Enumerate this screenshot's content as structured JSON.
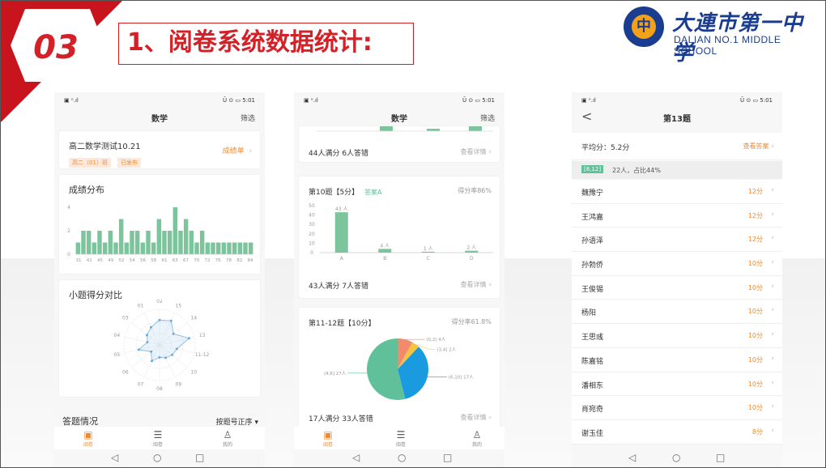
{
  "header": {
    "section_number": "03",
    "title": "1、阅卷系统数据统计:",
    "logo_cn": "大連市第一中学",
    "logo_en": "DALIAN NO.1 MIDDLE SCHOOL",
    "logo_mark": "中"
  },
  "phone1": {
    "status_left": "▣ ᵒ.ıl",
    "status_right": "Ū ⊙ ▭ 5:01",
    "nav_title": "数学",
    "nav_filter": "筛选",
    "exam": {
      "name": "高二数学测试10.21",
      "tag_class": "高二（01）班",
      "tag_status": "已发布",
      "link": "成绩单"
    },
    "distribution": {
      "title": "成绩分布",
      "y_ticks": [
        "4",
        "2",
        "0"
      ],
      "x_ticks": [
        "31",
        "41",
        "45",
        "49",
        "52",
        "54",
        "56",
        "58",
        "61",
        "63",
        "67",
        "70",
        "72",
        "76",
        "78",
        "82",
        "84"
      ]
    },
    "radar": {
      "title": "小题得分对比",
      "labels": [
        "01",
        "02",
        "15",
        "14",
        "13",
        "11-12",
        "10",
        "09",
        "08",
        "07",
        "06",
        "05",
        "04",
        "03"
      ]
    },
    "answer": {
      "title": "答题情况",
      "sort": "按题号正序"
    },
    "bottom_nav": [
      "阅卷",
      "阅卷",
      "我的"
    ],
    "sys_nav": [
      "◁",
      "○",
      "□"
    ]
  },
  "phone2": {
    "status_left": "▣ ᵒ.ıl",
    "status_right": "Ū ⊙ ▭ 5:01",
    "nav_title": "数学",
    "nav_filter": "筛选",
    "prev_summary": "44人满分 6人答错",
    "detail_link": "查看详情",
    "q10": {
      "title": "第10题【5分】",
      "answer": "答案A",
      "rate": "得分率86%",
      "summary": "43人满分 7人答错"
    },
    "q11": {
      "title": "第11-12题【10分】",
      "rate": "得分率61.8%",
      "summary": "17人满分 33人答错",
      "labels": [
        "(0,2) 4人",
        "(3,4] 2人",
        "(6,10] 17人",
        "(4,6] 27人"
      ]
    },
    "bottom_nav": [
      "阅卷",
      "阅卷",
      "我的"
    ],
    "sys_nav": [
      "◁",
      "○",
      "□"
    ]
  },
  "chart_data": [
    {
      "type": "bar",
      "title": "成绩分布",
      "ylim": [
        0,
        4
      ],
      "values": [
        1,
        2,
        2,
        1,
        2,
        1,
        2,
        1,
        3,
        1,
        2,
        2,
        1,
        2,
        1,
        3,
        2,
        2,
        4,
        2,
        3,
        2,
        1,
        2,
        1,
        1,
        1,
        1,
        1,
        1,
        1,
        1,
        1
      ],
      "color": "#7cc49c"
    },
    {
      "type": "bar",
      "title": "第10题【5分】",
      "categories": [
        "A",
        "B",
        "C",
        "D"
      ],
      "values": [
        43,
        4,
        1,
        2
      ],
      "labels": [
        "43 人",
        "4 人",
        "1 人",
        "2 人"
      ],
      "y_ticks": [
        "50",
        "40",
        "30",
        "20",
        "10",
        "0"
      ],
      "ylim": [
        0,
        50
      ],
      "color": "#7cc49c"
    },
    {
      "type": "pie",
      "title": "第11-12题【10分】",
      "categories": [
        "(0,2]",
        "(3,4]",
        "(6,10]",
        "(4,6]"
      ],
      "values": [
        4,
        2,
        17,
        27
      ],
      "colors": [
        "#f28b6e",
        "#f5c542",
        "#1a9be0",
        "#5fc09a"
      ]
    }
  ],
  "phone3": {
    "status_left": "▣ ᵒ.ıl",
    "status_right": "Ū ⊙ ▭ 5:01",
    "nav_back": "<",
    "nav_title": "第13题",
    "avg": "平均分：5.2分",
    "view_answer": "查看答案",
    "range_tag": "[8,12]",
    "range_info": "22人，占比44%",
    "students": [
      {
        "name": "魏豫宁",
        "score": "12分"
      },
      {
        "name": "王鸿嘉",
        "score": "12分"
      },
      {
        "name": "孙语泽",
        "score": "12分"
      },
      {
        "name": "孙勃侨",
        "score": "10分"
      },
      {
        "name": "王俊锡",
        "score": "10分"
      },
      {
        "name": "杨阳",
        "score": "10分"
      },
      {
        "name": "王思彧",
        "score": "10分"
      },
      {
        "name": "陈嘉铭",
        "score": "10分"
      },
      {
        "name": "潘相东",
        "score": "10分"
      },
      {
        "name": "肖宛奇",
        "score": "10分"
      },
      {
        "name": "谢玉佳",
        "score": "8分"
      }
    ],
    "sys_nav": [
      "◁",
      "○",
      "□"
    ]
  }
}
